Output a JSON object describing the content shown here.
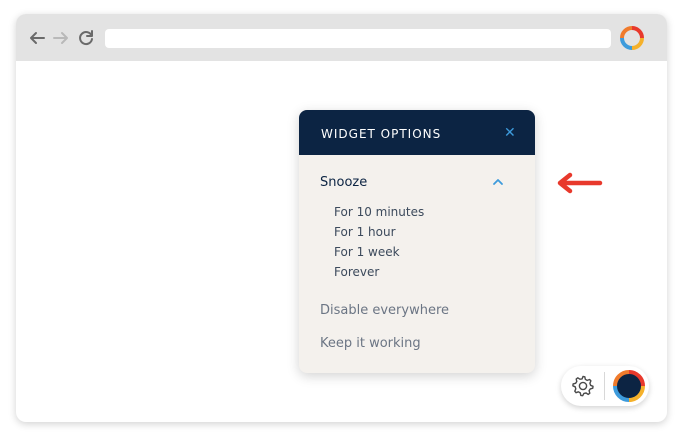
{
  "browser": {
    "address_value": "",
    "icons": {
      "back": "arrow-left-icon",
      "forward": "arrow-right-icon",
      "reload": "reload-icon",
      "logo": "ring-logo-icon"
    }
  },
  "widget_options": {
    "title": "WIDGET OPTIONS",
    "close_label": "✕",
    "snooze": {
      "label": "Snooze",
      "expanded": true,
      "options": [
        "For 10 minutes",
        "For 1 hour",
        "For 1 week",
        "Forever"
      ]
    },
    "disable_label": "Disable everywhere",
    "keep_label": "Keep it working"
  },
  "floating_widget": {
    "icons": {
      "settings": "gear-icon",
      "logo": "ring-logo-icon"
    }
  },
  "colors": {
    "header_bg": "#0c2443",
    "panel_bg": "#f4f1ed",
    "accent_blue": "#3d9bdc",
    "arrow_red": "#e8392c",
    "toolbar_bg": "#e3e3e3"
  }
}
